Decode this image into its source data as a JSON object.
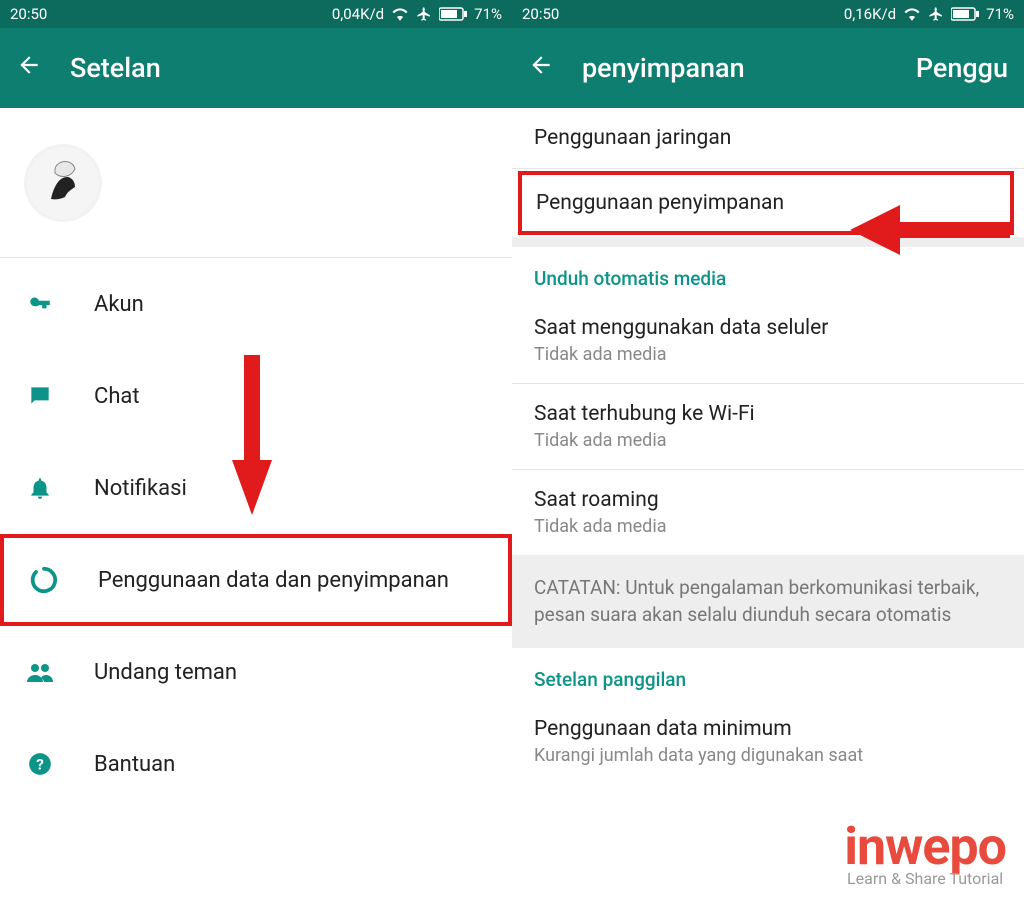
{
  "left": {
    "status": {
      "time": "20:50",
      "speed": "0,04K/d",
      "battery": "71%"
    },
    "appbar": {
      "title": "Setelan"
    },
    "settings": {
      "account": "Akun",
      "chat": "Chat",
      "notifications": "Notifikasi",
      "data_storage": "Penggunaan data dan penyimpanan",
      "invite": "Undang teman",
      "help": "Bantuan"
    }
  },
  "right": {
    "status": {
      "time": "20:50",
      "speed": "0,16K/d",
      "battery": "71%"
    },
    "appbar": {
      "title": "penyimpanan",
      "extra": "Penggu"
    },
    "network_usage": "Penggunaan jaringan",
    "storage_usage": "Penggunaan penyimpanan",
    "section_auto": "Unduh otomatis media",
    "cellular": {
      "title": "Saat menggunakan data seluler",
      "sub": "Tidak ada media"
    },
    "wifi": {
      "title": "Saat terhubung ke Wi-Fi",
      "sub": "Tidak ada media"
    },
    "roaming": {
      "title": "Saat roaming",
      "sub": "Tidak ada media"
    },
    "note": "CATATAN: Untuk pengalaman berkomunikasi terbaik, pesan suara akan selalu diunduh secara otomatis",
    "section_call": "Setelan panggilan",
    "min_data": {
      "title": "Penggunaan data minimum",
      "sub": "Kurangi jumlah data yang digunakan saat"
    }
  },
  "watermark": {
    "brand": "inwepo",
    "tag": "Learn & Share Tutorial"
  }
}
